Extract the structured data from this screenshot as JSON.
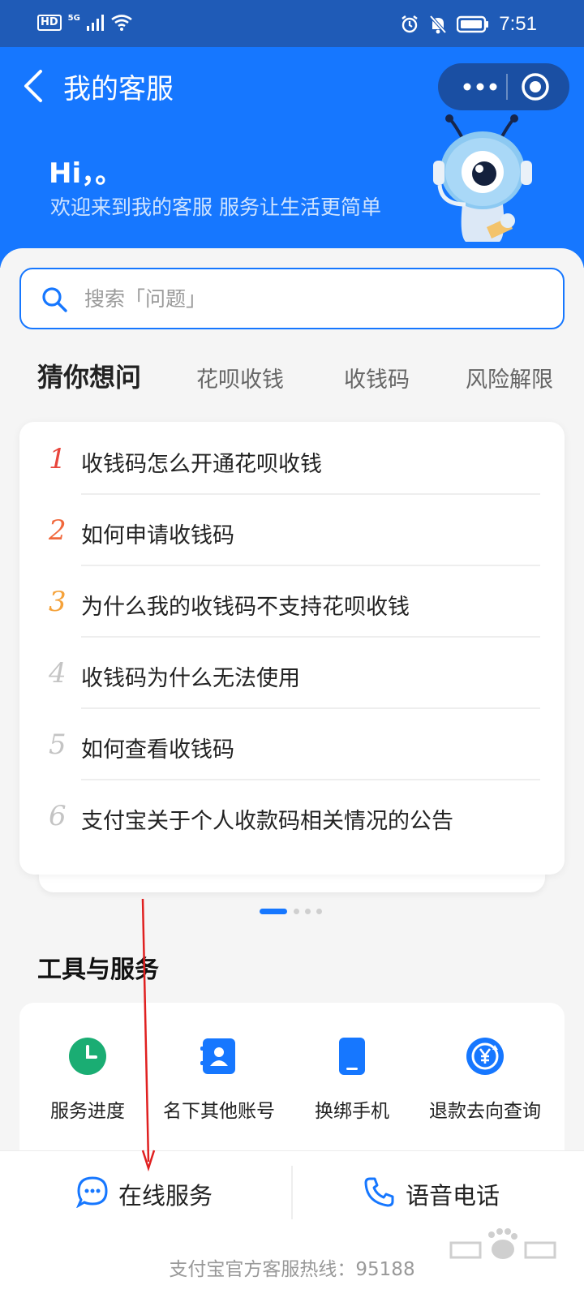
{
  "status_bar": {
    "time": "7:51",
    "hd": "HD",
    "network": "5G"
  },
  "header": {
    "title": "我的客服",
    "greeting": "Hi，。",
    "welcome": "欢迎来到我的客服 服务让生活更简单"
  },
  "search": {
    "placeholder": "搜索「问题」"
  },
  "tabs": [
    "猜你想问",
    "花呗收钱",
    "收钱码",
    "风险解限"
  ],
  "questions": [
    {
      "num": "1",
      "text": "收钱码怎么开通花呗收钱",
      "color": "#e8453c"
    },
    {
      "num": "2",
      "text": "如何申请收钱码",
      "color": "#f0683c"
    },
    {
      "num": "3",
      "text": "为什么我的收钱码不支持花呗收钱",
      "color": "#f5a23a"
    },
    {
      "num": "4",
      "text": "收钱码为什么无法使用",
      "color": "#c4c4c4"
    },
    {
      "num": "5",
      "text": "如何查看收钱码",
      "color": "#c4c4c4"
    },
    {
      "num": "6",
      "text": "支付宝关于个人收款码相关情况的公告",
      "color": "#c4c4c4"
    }
  ],
  "tools_section": {
    "title": "工具与服务",
    "items": [
      {
        "label": "服务进度",
        "icon": "clock-icon",
        "color": "#1aad73"
      },
      {
        "label": "名下其他账号",
        "icon": "contact-book-icon",
        "color": "#1677ff"
      },
      {
        "label": "换绑手机",
        "icon": "phone-icon",
        "color": "#1677ff"
      },
      {
        "label": "退款去向查询",
        "icon": "yuan-refund-icon",
        "color": "#1677ff"
      }
    ]
  },
  "bottom": {
    "online_label": "在线服务",
    "phone_label": "语音电话",
    "hotline": "支付宝官方客服热线：95188"
  },
  "colors": {
    "brand_blue": "#1677ff",
    "status_bar": "#1f5bb7",
    "annotation_arrow": "#e02020"
  }
}
